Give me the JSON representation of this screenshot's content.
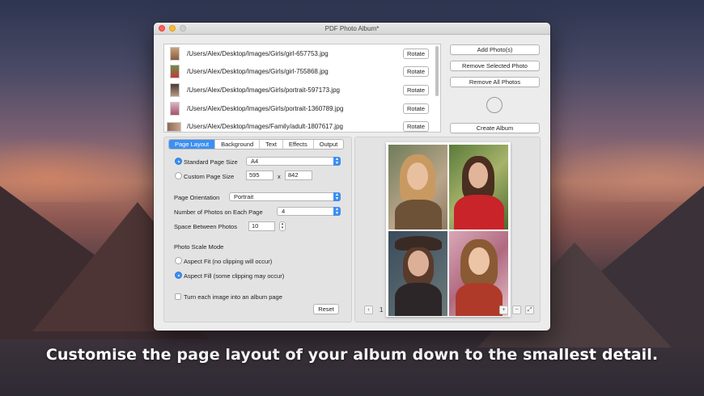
{
  "caption": "Customise the page layout of your album down to the smallest detail.",
  "window": {
    "title": "PDF Photo Album*"
  },
  "files": [
    {
      "path": "/Users/Alex/Desktop/Images/Girls/girl-657753.jpg",
      "rotate_label": "Rotate"
    },
    {
      "path": "/Users/Alex/Desktop/Images/Girls/girl-755868.jpg",
      "rotate_label": "Rotate"
    },
    {
      "path": "/Users/Alex/Desktop/Images/Girls/portrait-597173.jpg",
      "rotate_label": "Rotate"
    },
    {
      "path": "/Users/Alex/Desktop/Images/Girls/portrait-1360789.jpg",
      "rotate_label": "Rotate"
    },
    {
      "path": "/Users/Alex/Desktop/Images/Family/adult-1807617.jpg",
      "rotate_label": "Rotate"
    }
  ],
  "actions": {
    "add": "Add Photo(s)",
    "remove_selected": "Remove Selected Photo",
    "remove_all": "Remove All Photos",
    "create": "Create Album"
  },
  "tabs": [
    "Page Layout",
    "Background",
    "Text",
    "Effects",
    "Output"
  ],
  "layout": {
    "standard_size_label": "Standard Page Size",
    "standard_size_value": "A4",
    "custom_size_label": "Custom Page Size",
    "custom_width": "595",
    "times": "x",
    "custom_height": "842",
    "orientation_label": "Page Orientation",
    "orientation_value": "Portrait",
    "photos_per_page_label": "Number of Photos on Each Page",
    "photos_per_page_value": "4",
    "spacing_label": "Space Between Photos",
    "spacing_value": "10",
    "scale_mode_label": "Photo Scale Mode",
    "aspect_fit_label": "Aspect Fit (no clipping will occur)",
    "aspect_fill_label": "Aspect Fill (some clipping may occur)",
    "album_page_label": "Turn each image into an album page",
    "reset_label": "Reset"
  },
  "preview": {
    "page_number": "1",
    "prev_icon": "‹",
    "zoom_in_icon": "+",
    "zoom_out_icon": "−",
    "fullscreen_icon": "⤢"
  },
  "colors": {
    "accent": "#3d8ff0",
    "close": "#fc5f57",
    "minimize": "#fdbc2e"
  }
}
